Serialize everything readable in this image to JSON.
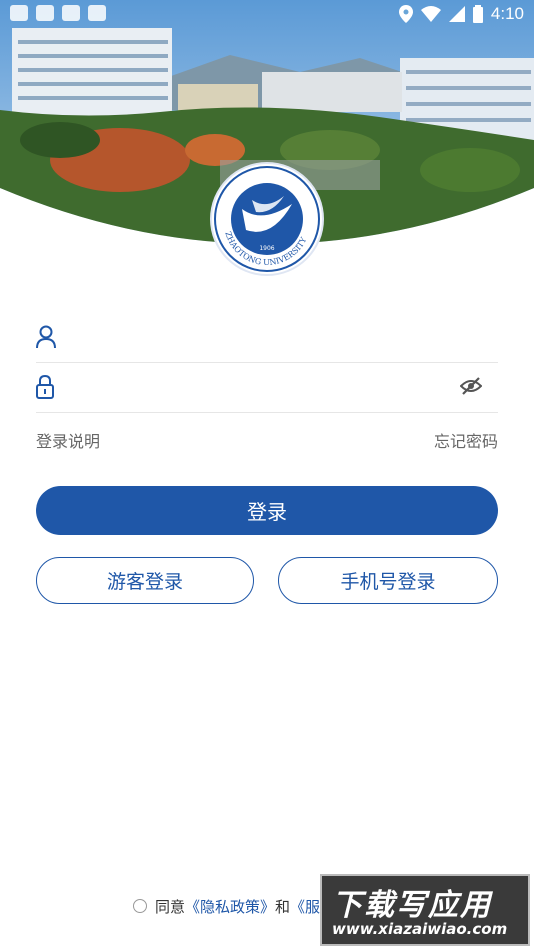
{
  "status_bar": {
    "time": "4:10"
  },
  "hero": {
    "logo_text": "ZHAOTONG UNIVERSITY",
    "logo_year": "1906"
  },
  "login": {
    "username_placeholder": "",
    "password_placeholder": "",
    "login_help": "登录说明",
    "forgot_password": "忘记密码",
    "login_button": "登录",
    "guest_login": "游客登录",
    "phone_login": "手机号登录"
  },
  "agreement": {
    "prefix": "同意",
    "privacy_policy": "《隐私政策》",
    "and": "和",
    "service_terms": "《服务..."
  },
  "watermark": {
    "title": "下载写应用",
    "site": "www.xiazaiwiao.com"
  },
  "colors": {
    "primary": "#1f57a8",
    "sky": "#6aa6d8"
  }
}
